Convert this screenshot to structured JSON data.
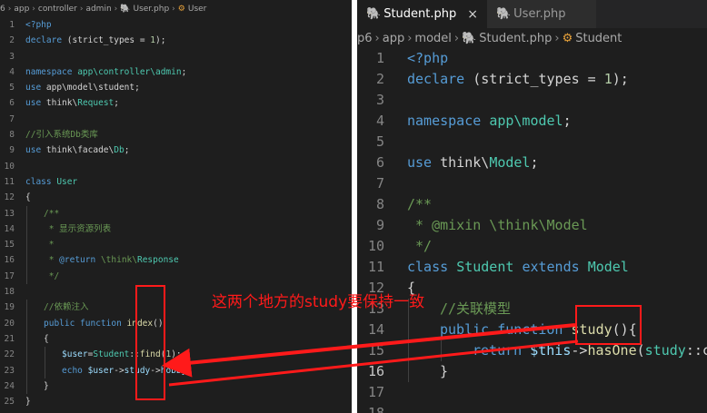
{
  "left_editor": {
    "breadcrumb": [
      "6",
      "app",
      "controller",
      "admin",
      "User.php",
      "User"
    ],
    "lines": [
      {
        "n": "1",
        "tokens": [
          {
            "t": "<?php",
            "c": "kw"
          }
        ]
      },
      {
        "n": "2",
        "tokens": [
          {
            "t": "declare",
            "c": "kw"
          },
          {
            "t": " (strict_types = ",
            "c": ""
          },
          {
            "t": "1",
            "c": "num"
          },
          {
            "t": ");",
            "c": ""
          }
        ]
      },
      {
        "n": "3",
        "tokens": []
      },
      {
        "n": "4",
        "tokens": [
          {
            "t": "namespace ",
            "c": "kw"
          },
          {
            "t": "app\\controller\\admin",
            "c": "cls"
          },
          {
            "t": ";",
            "c": ""
          }
        ]
      },
      {
        "n": "5",
        "tokens": [
          {
            "t": "use ",
            "c": "kw"
          },
          {
            "t": "app\\model\\student",
            "c": ""
          },
          {
            "t": ";",
            "c": ""
          }
        ]
      },
      {
        "n": "6",
        "tokens": [
          {
            "t": "use ",
            "c": "kw"
          },
          {
            "t": "think\\",
            "c": ""
          },
          {
            "t": "Request",
            "c": "cls"
          },
          {
            "t": ";",
            "c": ""
          }
        ]
      },
      {
        "n": "7",
        "tokens": []
      },
      {
        "n": "8",
        "tokens": [
          {
            "t": "//引入系统Db类库",
            "c": "cmt"
          }
        ]
      },
      {
        "n": "9",
        "tokens": [
          {
            "t": "use ",
            "c": "kw"
          },
          {
            "t": "think\\facade\\",
            "c": ""
          },
          {
            "t": "Db",
            "c": "cls"
          },
          {
            "t": ";",
            "c": ""
          }
        ]
      },
      {
        "n": "10",
        "tokens": []
      },
      {
        "n": "11",
        "tokens": [
          {
            "t": "class ",
            "c": "kw"
          },
          {
            "t": "User",
            "c": "cls"
          }
        ]
      },
      {
        "n": "12",
        "tokens": [
          {
            "t": "{",
            "c": ""
          }
        ]
      },
      {
        "n": "13",
        "indent": 1,
        "tokens": [
          {
            "t": "/**",
            "c": "cmt"
          }
        ]
      },
      {
        "n": "14",
        "indent": 1,
        "tokens": [
          {
            "t": " * 显示资源列表",
            "c": "cmt"
          }
        ]
      },
      {
        "n": "15",
        "indent": 1,
        "tokens": [
          {
            "t": " *",
            "c": "cmt"
          }
        ]
      },
      {
        "n": "16",
        "indent": 1,
        "tokens": [
          {
            "t": " * ",
            "c": "cmt"
          },
          {
            "t": "@return",
            "c": "kw"
          },
          {
            "t": " \\think\\",
            "c": "cmt"
          },
          {
            "t": "Response",
            "c": "cls"
          }
        ]
      },
      {
        "n": "17",
        "indent": 1,
        "tokens": [
          {
            "t": " */",
            "c": "cmt"
          }
        ]
      },
      {
        "n": "18",
        "tokens": []
      },
      {
        "n": "19",
        "indent": 1,
        "tokens": [
          {
            "t": "//依赖注入",
            "c": "cmt"
          }
        ]
      },
      {
        "n": "20",
        "indent": 1,
        "tokens": [
          {
            "t": "public function ",
            "c": "kw"
          },
          {
            "t": "index",
            "c": "fn"
          },
          {
            "t": "()",
            "c": ""
          }
        ]
      },
      {
        "n": "21",
        "indent": 1,
        "tokens": [
          {
            "t": "{",
            "c": ""
          }
        ]
      },
      {
        "n": "22",
        "indent": 2,
        "tokens": [
          {
            "t": "$user",
            "c": "var"
          },
          {
            "t": "=",
            "c": ""
          },
          {
            "t": "Student",
            "c": "cls"
          },
          {
            "t": "::",
            "c": ""
          },
          {
            "t": "find",
            "c": "fn"
          },
          {
            "t": "(",
            "c": ""
          },
          {
            "t": "1",
            "c": "num"
          },
          {
            "t": ");",
            "c": ""
          }
        ]
      },
      {
        "n": "23",
        "indent": 2,
        "tokens": [
          {
            "t": "echo ",
            "c": "kw"
          },
          {
            "t": "$user",
            "c": "var"
          },
          {
            "t": "->",
            "c": ""
          },
          {
            "t": "study",
            "c": "var"
          },
          {
            "t": "->",
            "c": ""
          },
          {
            "t": "hobby",
            "c": "var"
          },
          {
            "t": ";",
            "c": ""
          }
        ]
      },
      {
        "n": "24",
        "indent": 1,
        "tokens": [
          {
            "t": "}",
            "c": ""
          }
        ]
      },
      {
        "n": "25",
        "tokens": [
          {
            "t": "}",
            "c": ""
          }
        ]
      }
    ]
  },
  "right_editor": {
    "tabs": [
      {
        "label": "Student.php",
        "active": true,
        "close": "×"
      },
      {
        "label": "User.php",
        "active": false
      }
    ],
    "breadcrumb": [
      "p6",
      "app",
      "model",
      "Student.php",
      "Student"
    ],
    "current_line": "16",
    "lines": [
      {
        "n": "1",
        "tokens": [
          {
            "t": "<?php",
            "c": "kw"
          }
        ]
      },
      {
        "n": "2",
        "tokens": [
          {
            "t": "declare",
            "c": "kw"
          },
          {
            "t": " (strict_types = ",
            "c": ""
          },
          {
            "t": "1",
            "c": "num"
          },
          {
            "t": ");",
            "c": ""
          }
        ]
      },
      {
        "n": "3",
        "tokens": []
      },
      {
        "n": "4",
        "tokens": [
          {
            "t": "namespace ",
            "c": "kw"
          },
          {
            "t": "app\\model",
            "c": "cls"
          },
          {
            "t": ";",
            "c": ""
          }
        ]
      },
      {
        "n": "5",
        "tokens": []
      },
      {
        "n": "6",
        "tokens": [
          {
            "t": "use ",
            "c": "kw"
          },
          {
            "t": "think\\",
            "c": ""
          },
          {
            "t": "Model",
            "c": "cls"
          },
          {
            "t": ";",
            "c": ""
          }
        ]
      },
      {
        "n": "7",
        "tokens": []
      },
      {
        "n": "8",
        "tokens": [
          {
            "t": "/**",
            "c": "cmt"
          }
        ]
      },
      {
        "n": "9",
        "tokens": [
          {
            "t": " * @mixin \\think\\Model",
            "c": "cmt"
          }
        ]
      },
      {
        "n": "10",
        "tokens": [
          {
            "t": " */",
            "c": "cmt"
          }
        ]
      },
      {
        "n": "11",
        "tokens": [
          {
            "t": "class ",
            "c": "kw"
          },
          {
            "t": "Student ",
            "c": "cls"
          },
          {
            "t": "extends ",
            "c": "kw"
          },
          {
            "t": "Model",
            "c": "cls"
          }
        ]
      },
      {
        "n": "12",
        "tokens": [
          {
            "t": "{",
            "c": ""
          }
        ]
      },
      {
        "n": "13",
        "indent": 1,
        "tokens": [
          {
            "t": "//关联模型",
            "c": "cmt"
          }
        ]
      },
      {
        "n": "14",
        "indent": 1,
        "tokens": [
          {
            "t": "public function ",
            "c": "kw"
          },
          {
            "t": "study",
            "c": "fn"
          },
          {
            "t": "(){",
            "c": ""
          }
        ]
      },
      {
        "n": "15",
        "indent": 2,
        "tokens": [
          {
            "t": "return ",
            "c": "kw"
          },
          {
            "t": "$this",
            "c": "var"
          },
          {
            "t": "->",
            "c": ""
          },
          {
            "t": "hasOne",
            "c": "fn"
          },
          {
            "t": "(",
            "c": ""
          },
          {
            "t": "study",
            "c": "cls"
          },
          {
            "t": "::cla",
            "c": ""
          }
        ]
      },
      {
        "n": "16",
        "indent": 1,
        "tokens": [
          {
            "t": "}",
            "c": ""
          }
        ]
      },
      {
        "n": "17",
        "tokens": []
      },
      {
        "n": "18",
        "tokens": []
      }
    ]
  },
  "annotation": {
    "text": "这两个地方的study要保持一致",
    "color": "#ff1a1a"
  }
}
